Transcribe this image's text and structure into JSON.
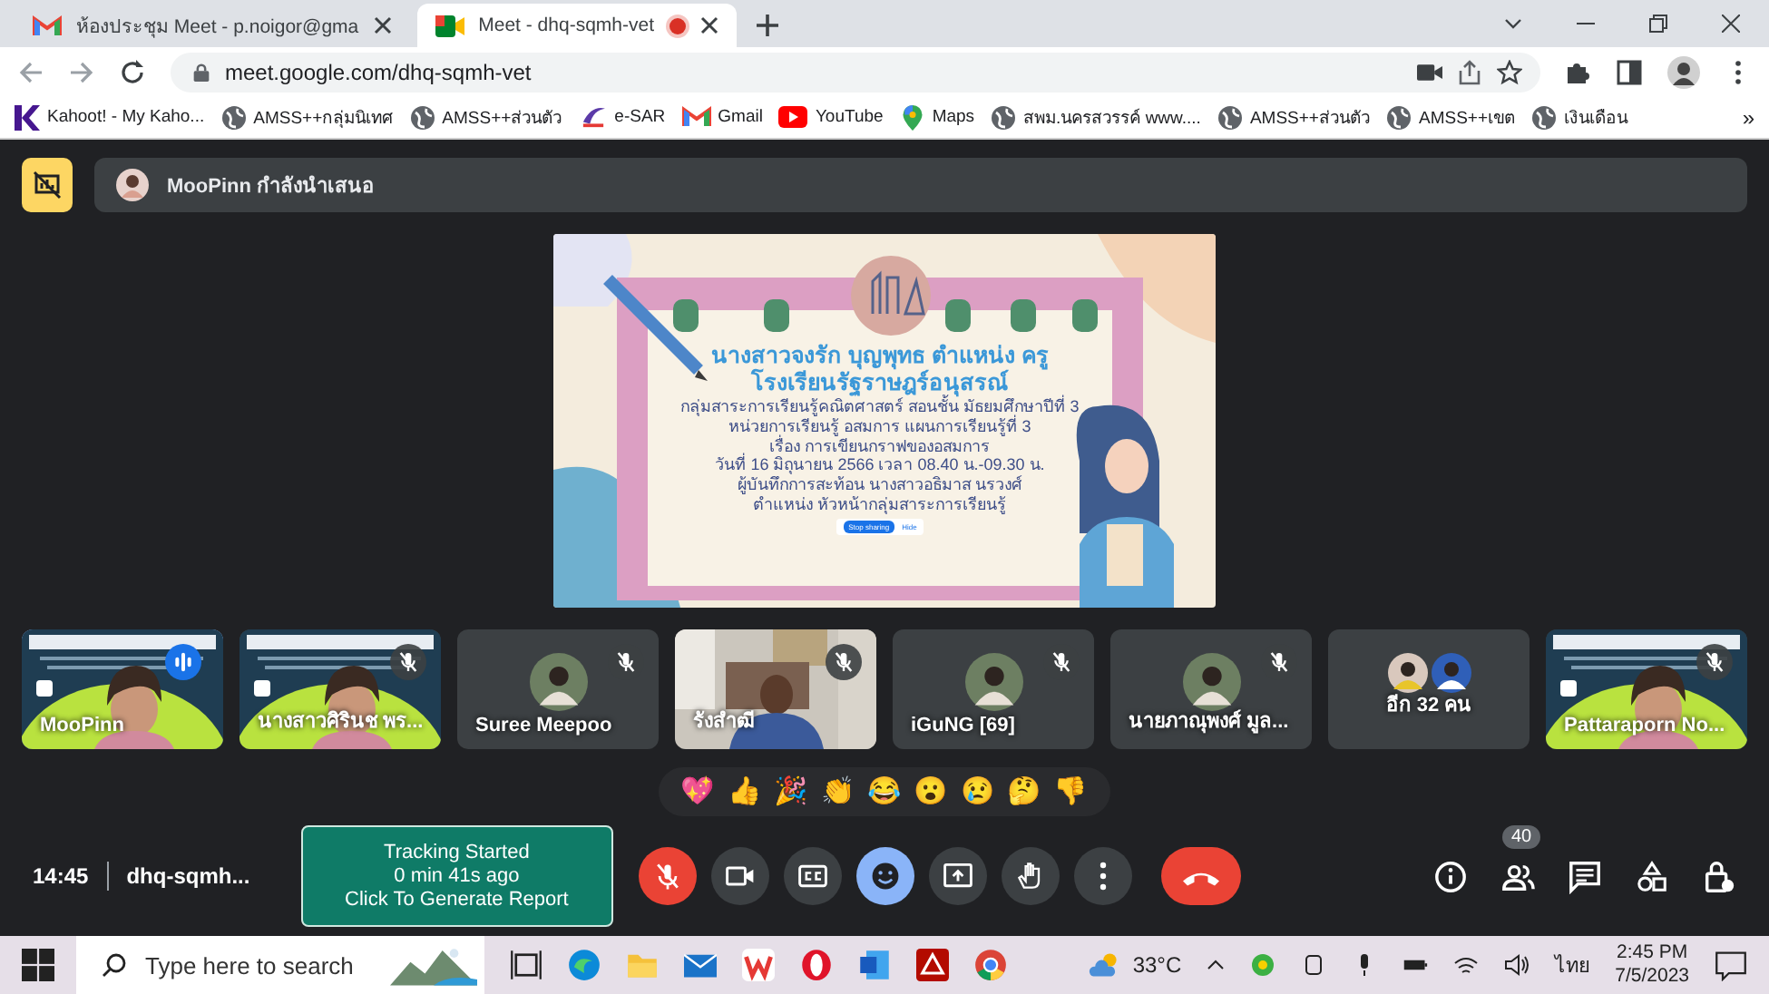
{
  "browser": {
    "tabs": [
      {
        "title": "ห้องประชุม Meet - p.noigor@gma",
        "kind": "mail",
        "selected": false,
        "recording": false
      },
      {
        "title": "Meet - dhq-sqmh-vet",
        "kind": "meet",
        "selected": true,
        "recording": true
      }
    ],
    "address": "meet.google.com/dhq-sqmh-vet",
    "bookmarks": [
      {
        "label": "Kahoot! - My Kaho...",
        "kind": "kahoot"
      },
      {
        "label": "AMSS++กลุ่มนิเทศ",
        "kind": "globe"
      },
      {
        "label": "AMSS++ส่วนตัว",
        "kind": "globe"
      },
      {
        "label": "e-SAR",
        "kind": "esar"
      },
      {
        "label": "Gmail",
        "kind": "mail"
      },
      {
        "label": "YouTube",
        "kind": "youtube"
      },
      {
        "label": "Maps",
        "kind": "maps"
      },
      {
        "label": "สพม.นครสวรรค์ www....",
        "kind": "globe"
      },
      {
        "label": "AMSS++ส่วนตัว",
        "kind": "globe"
      },
      {
        "label": "AMSS++เขต",
        "kind": "globe"
      },
      {
        "label": "เงินเดือน",
        "kind": "globe"
      }
    ],
    "more_bookmarks": "»"
  },
  "meet": {
    "presenter": "MooPinn กำลังนำเสนอ",
    "slide": {
      "lines": [
        {
          "text": "นางสาวจงรัก บุญพุทธ ตำแหน่ง ครู",
          "kind": "title"
        },
        {
          "text": "โรงเรียนรัฐราษฎร์อนุสรณ์",
          "kind": "title"
        },
        {
          "text": "กลุ่มสาระการเรียนรู้คณิตศาสตร์ สอนชั้น มัธยมศึกษาปีที่ 3",
          "kind": "body"
        },
        {
          "text": "หน่วยการเรียนรู้ อสมการ แผนการเรียนรู้ที่ 3",
          "kind": "body"
        },
        {
          "text": "เรื่อง การเขียนกราฟของอสมการ",
          "kind": "body"
        },
        {
          "text": "วันที่ 16 มิถุนายน 2566  เวลา 08.40 น.-09.30 น.",
          "kind": "body"
        },
        {
          "text": "ผู้บันทึกการสะท้อน  นางสาวอธิมาส  นรวงศ์",
          "kind": "body"
        },
        {
          "text": "ตำแหน่ง หัวหน้ากลุ่มสาระการเรียนรู้",
          "kind": "body"
        }
      ],
      "share_bar": {
        "stop": "Stop sharing",
        "hide": "Hide"
      }
    },
    "tiles": [
      {
        "name": "MooPinn",
        "kind": "video",
        "muted": false,
        "speaking": true
      },
      {
        "name": "นางสาวศิรินช พร...",
        "kind": "video",
        "muted": true,
        "speaking": false
      },
      {
        "name": "Suree Meepoo",
        "kind": "avatar",
        "muted": true,
        "speaking": false
      },
      {
        "name": "รังสำฒี",
        "kind": "camera",
        "muted": true,
        "speaking": false
      },
      {
        "name": "iGuNG [69]",
        "kind": "avatar",
        "muted": true,
        "speaking": false
      },
      {
        "name": "นายภาณุพงศ์ มูล...",
        "kind": "avatar",
        "muted": true,
        "speaking": false
      },
      {
        "name": "อีก 32 คน",
        "kind": "more",
        "muted": false,
        "speaking": false
      },
      {
        "name": "Pattaraporn No...",
        "kind": "video",
        "muted": true,
        "speaking": false
      }
    ],
    "reactions": [
      "💖",
      "👍",
      "🎉",
      "👏",
      "😂",
      "😮",
      "😢",
      "🤔",
      "👎"
    ],
    "time": "14:45",
    "meeting_code": "dhq-sqmh...",
    "tracking": [
      "Tracking Started",
      "0 min 41s ago",
      "Click To Generate Report"
    ],
    "controls": [
      {
        "kind": "mic",
        "on": false
      },
      {
        "kind": "camera",
        "on": true
      },
      {
        "kind": "captions",
        "on": true
      },
      {
        "kind": "reactions",
        "selected": true
      },
      {
        "kind": "present",
        "on": true
      },
      {
        "kind": "hand",
        "on": true
      },
      {
        "kind": "more",
        "on": true
      },
      {
        "kind": "leave"
      }
    ],
    "people_count": "40"
  },
  "taskbar": {
    "search_placeholder": "Type here to search",
    "temperature": "33°C",
    "language": "ไทย",
    "time": "2:45 PM",
    "date": "7/5/2023"
  }
}
